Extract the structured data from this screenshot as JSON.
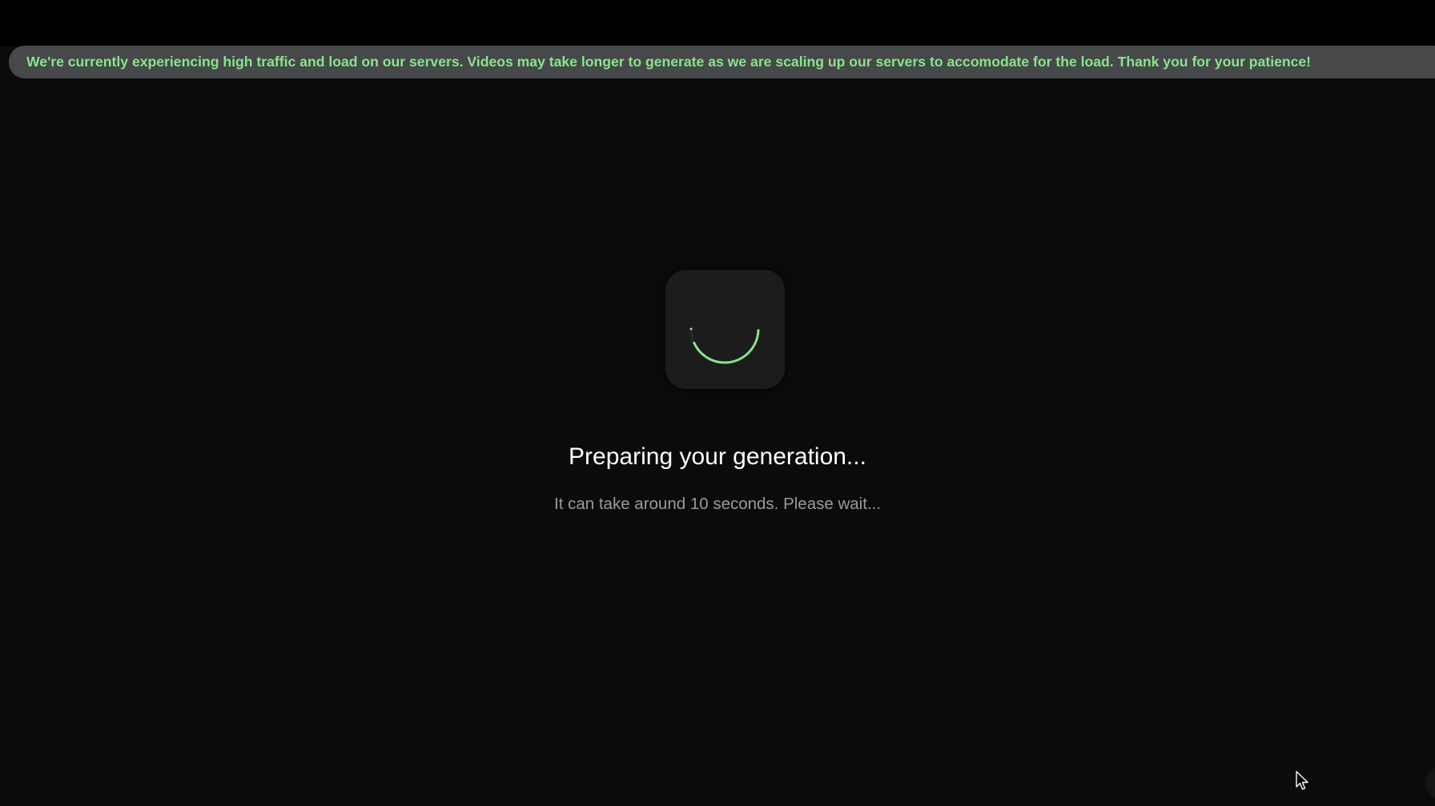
{
  "banner": {
    "message": "We're currently experiencing high traffic and load on our servers. Videos may take longer to generate as we are scaling up our servers to accomodate for the load. Thank you for your patience!"
  },
  "loader": {
    "icon": "spinner-icon",
    "accent_color": "#86e58a"
  },
  "status": {
    "title": "Preparing your generation...",
    "subtitle": "It can take around 10 seconds. Please wait..."
  },
  "colors": {
    "background": "#0b0b0b",
    "banner_bg": "#46484a",
    "banner_text": "#86e58a",
    "card_bg": "#1c1c1c"
  }
}
